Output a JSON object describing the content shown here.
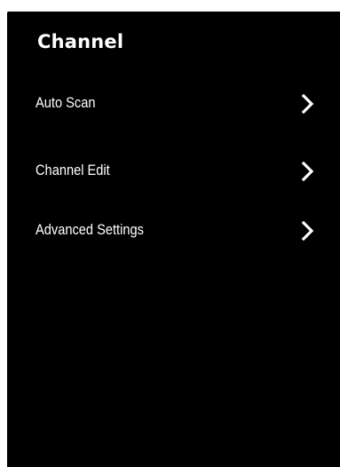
{
  "menu": {
    "title": "Channel",
    "items": [
      {
        "label": "Auto Scan",
        "icon": "chevron-right-icon"
      },
      {
        "label": "Channel Edit",
        "icon": "chevron-right-icon"
      },
      {
        "label": "Advanced Settings",
        "icon": "chevron-right-icon"
      }
    ]
  },
  "colors": {
    "background": "#000000",
    "text": "#ffffff"
  }
}
